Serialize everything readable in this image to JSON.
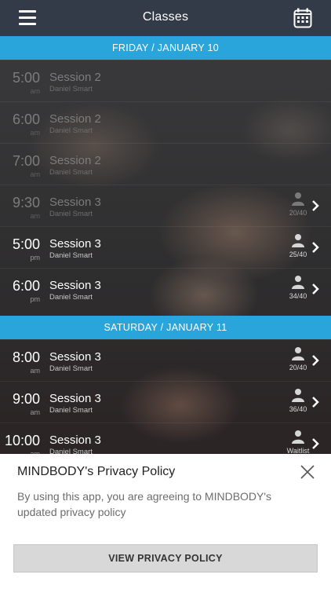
{
  "header": {
    "title": "Classes"
  },
  "days": [
    {
      "label": "FRIDAY / JANUARY 10",
      "classes": [
        {
          "time": "5:00",
          "ampm": "am",
          "name": "Session 2",
          "instructor": "Daniel Smart",
          "count": ""
        },
        {
          "time": "6:00",
          "ampm": "am",
          "name": "Session 2",
          "instructor": "Daniel Smart",
          "count": ""
        },
        {
          "time": "7:00",
          "ampm": "am",
          "name": "Session 2",
          "instructor": "Daniel Smart",
          "count": ""
        },
        {
          "time": "9:30",
          "ampm": "am",
          "name": "Session 3",
          "instructor": "Daniel Smart",
          "count": "20/40"
        },
        {
          "time": "5:00",
          "ampm": "pm",
          "name": "Session 3",
          "instructor": "Daniel Smart",
          "count": "25/40"
        },
        {
          "time": "6:00",
          "ampm": "pm",
          "name": "Session 3",
          "instructor": "Daniel Smart",
          "count": "34/40"
        }
      ]
    },
    {
      "label": "SATURDAY / JANUARY 11",
      "classes": [
        {
          "time": "8:00",
          "ampm": "am",
          "name": "Session 3",
          "instructor": "Daniel Smart",
          "count": "20/40"
        },
        {
          "time": "9:00",
          "ampm": "am",
          "name": "Session 3",
          "instructor": "Daniel Smart",
          "count": "36/40"
        },
        {
          "time": "10:00",
          "ampm": "am",
          "name": "Session 3",
          "instructor": "Daniel Smart",
          "count": "Waitlist"
        }
      ]
    }
  ],
  "privacy": {
    "title": "MINDBODY's Privacy Policy",
    "body": "By using this app, you are agreeing to MINDBODY's updated privacy policy",
    "button": "VIEW PRIVACY POLICY"
  },
  "colors": {
    "header": "#333a48",
    "band": "#2aa5dc",
    "sheet": "#ffffff"
  }
}
